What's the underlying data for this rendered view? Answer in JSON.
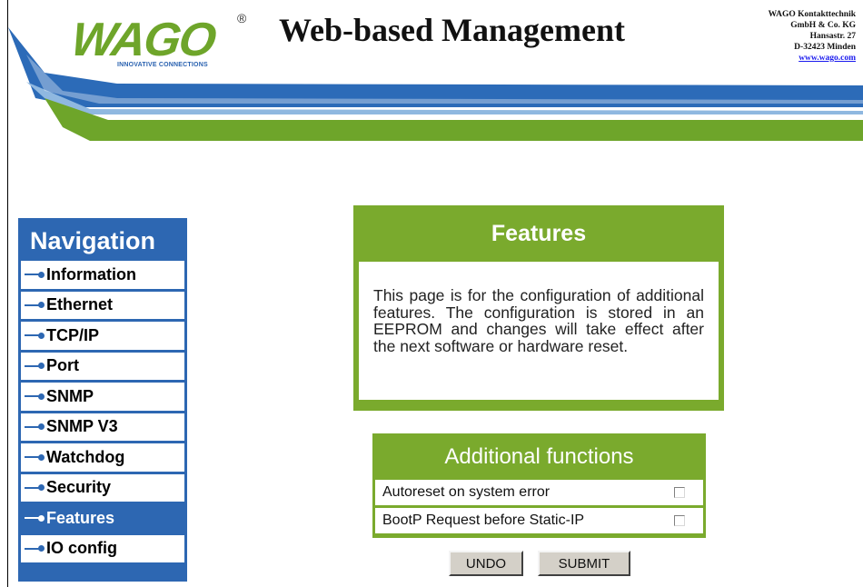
{
  "header": {
    "logo_text": "WAGO",
    "logo_registered": "®",
    "logo_tagline": "INNOVATIVE CONNECTIONS",
    "title": "Web-based Management",
    "address_lines": [
      "WAGO Kontakttechnik",
      "GmbH & Co. KG",
      "Hansastr. 27",
      "D-32423 Minden"
    ],
    "website": "www.wago.com"
  },
  "colors": {
    "nav_blue": "#2d67b2",
    "wago_green": "#7aaa2d",
    "banner_blue": "#2c6bb8"
  },
  "nav": {
    "title": "Navigation",
    "items": [
      {
        "label": "Information",
        "active": false
      },
      {
        "label": "Ethernet",
        "active": false
      },
      {
        "label": "TCP/IP",
        "active": false
      },
      {
        "label": "Port",
        "active": false
      },
      {
        "label": "SNMP",
        "active": false
      },
      {
        "label": "SNMP V3",
        "active": false
      },
      {
        "label": "Watchdog",
        "active": false
      },
      {
        "label": "Security",
        "active": false
      },
      {
        "label": "Features",
        "active": true
      },
      {
        "label": "IO config",
        "active": false
      }
    ]
  },
  "features": {
    "title": "Features",
    "description": "This page is for the configuration of additional features. The configuration is stored in an EEPROM and changes will take effect after the next software or hardware reset."
  },
  "additional_functions": {
    "title": "Additional functions",
    "options": [
      {
        "label": "Autoreset on system error",
        "checked": false
      },
      {
        "label": "BootP Request before Static-IP",
        "checked": false
      }
    ]
  },
  "buttons": {
    "undo": "UNDO",
    "submit": "SUBMIT"
  }
}
